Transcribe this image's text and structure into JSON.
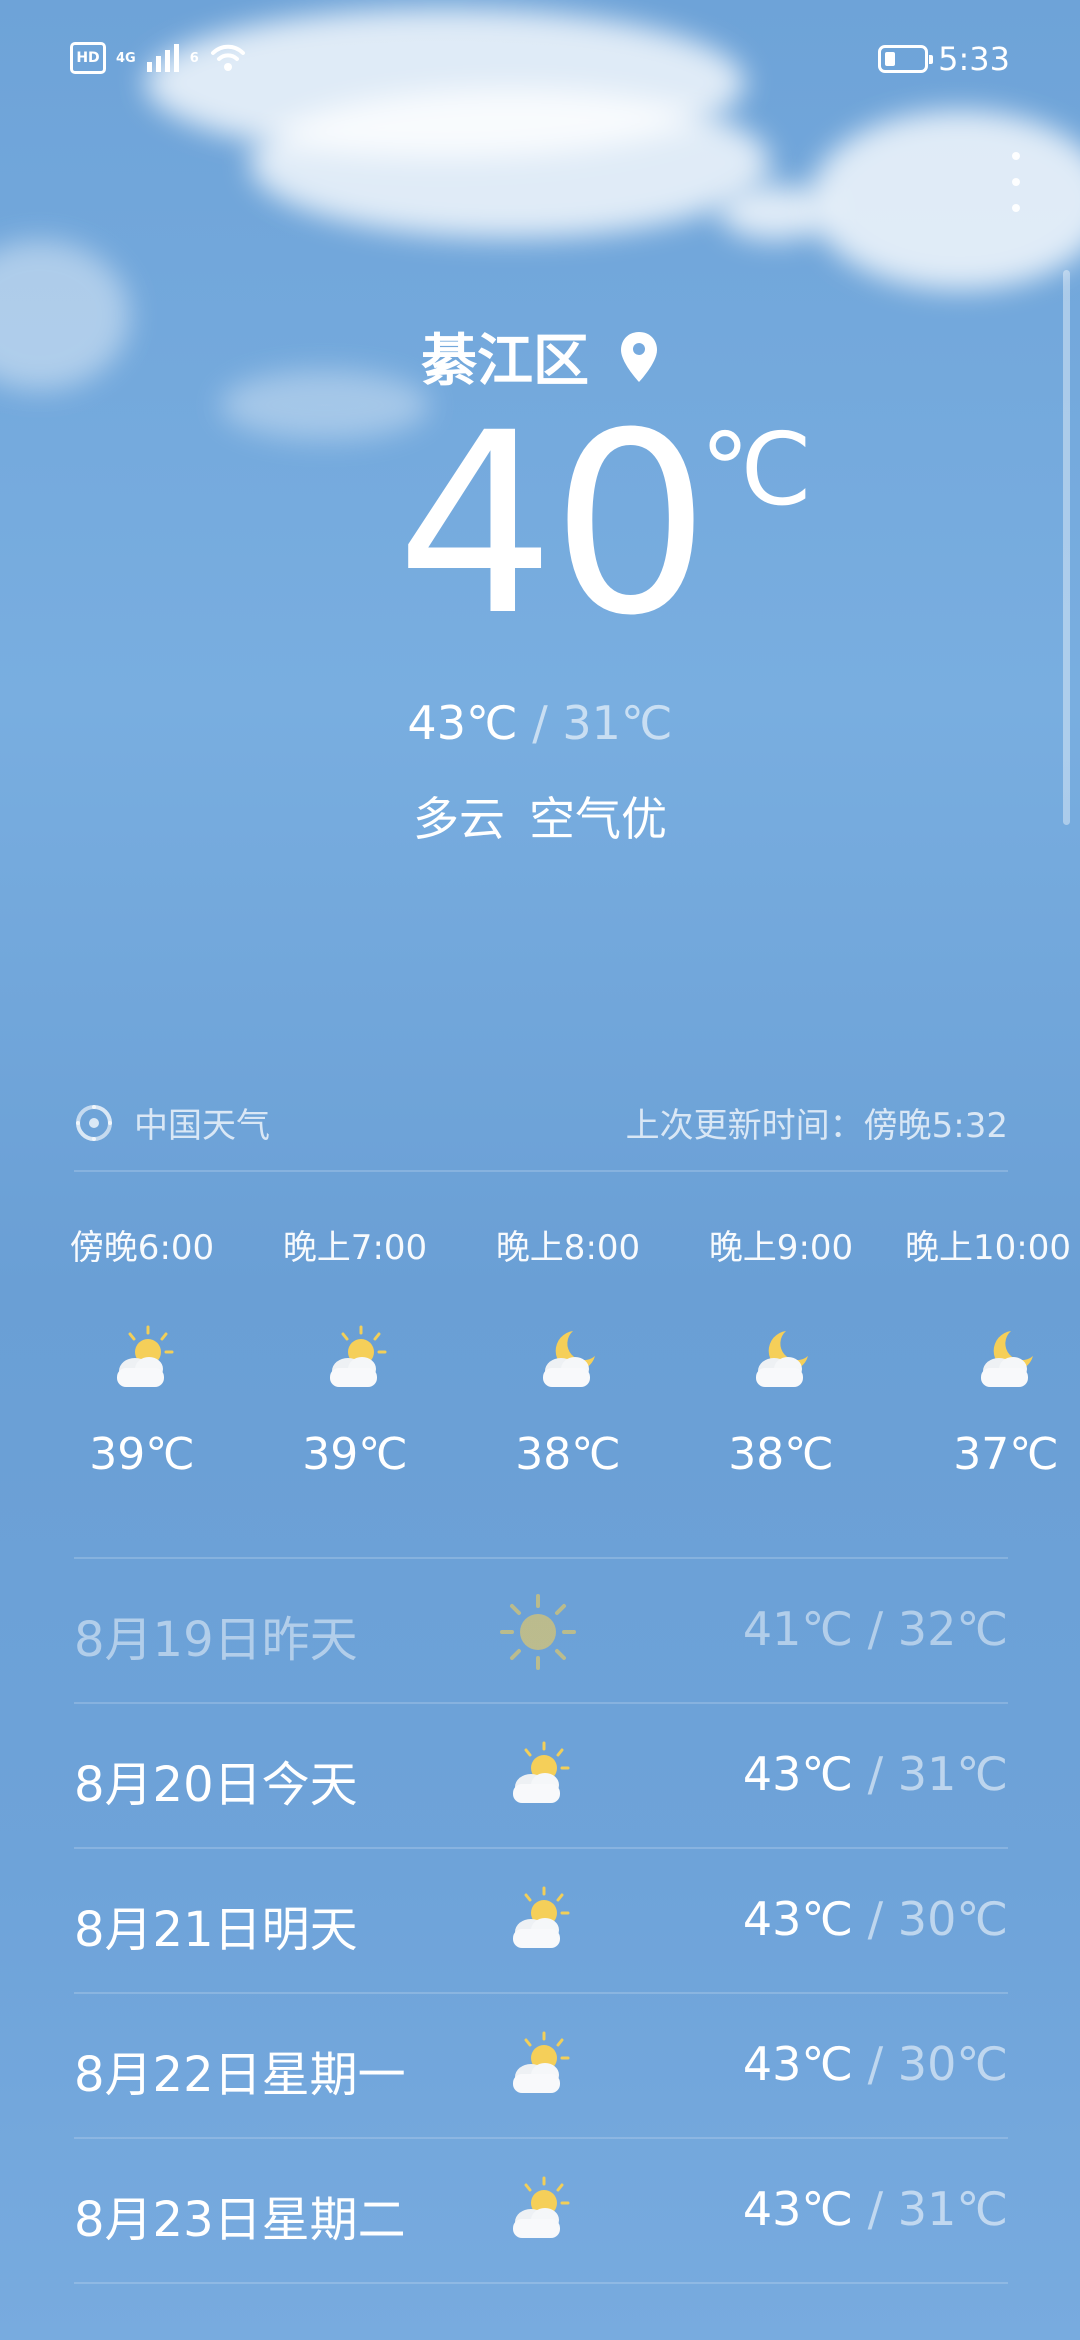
{
  "status_bar": {
    "hd": "HD",
    "signal_1": "4G",
    "signal_2": "6",
    "battery_level": 0.28,
    "time": "5:33"
  },
  "location": {
    "city": "綦江区",
    "icon": "location-pin-icon"
  },
  "current": {
    "temperature": "40",
    "unit": "℃",
    "high": "43℃",
    "separator": " / ",
    "low": "31℃",
    "condition": "多云",
    "air_quality": "空气优"
  },
  "source": {
    "name": "中国天气",
    "icon": "china-weather-logo-icon",
    "updated": "上次更新时间：傍晚5:32"
  },
  "hourly": [
    {
      "time": "傍晚6:00",
      "icon": "partly-cloudy-day-icon",
      "temp": "39℃"
    },
    {
      "time": "晚上7:00",
      "icon": "partly-cloudy-day-icon",
      "temp": "39℃"
    },
    {
      "time": "晚上8:00",
      "icon": "partly-cloudy-night-icon",
      "temp": "38℃"
    },
    {
      "time": "晚上9:00",
      "icon": "partly-cloudy-night-icon",
      "temp": "38℃"
    },
    {
      "time": "晚上10:00",
      "icon": "partly-cloudy-night-icon",
      "temp": "37℃"
    }
  ],
  "daily": [
    {
      "label": "8月19日昨天",
      "icon": "sunny-icon",
      "high": "41℃",
      "separator": " / ",
      "low": "32℃",
      "past": true
    },
    {
      "label": "8月20日今天",
      "icon": "partly-cloudy-day-icon",
      "high": "43℃",
      "separator": " / ",
      "low": "31℃",
      "past": false
    },
    {
      "label": "8月21日明天",
      "icon": "partly-cloudy-day-icon",
      "high": "43℃",
      "separator": " / ",
      "low": "30℃",
      "past": false
    },
    {
      "label": "8月22日星期一",
      "icon": "partly-cloudy-day-icon",
      "high": "43℃",
      "separator": " / ",
      "low": "30℃",
      "past": false
    },
    {
      "label": "8月23日星期二",
      "icon": "partly-cloudy-day-icon",
      "high": "43℃",
      "separator": " / ",
      "low": "31℃",
      "past": false
    }
  ]
}
